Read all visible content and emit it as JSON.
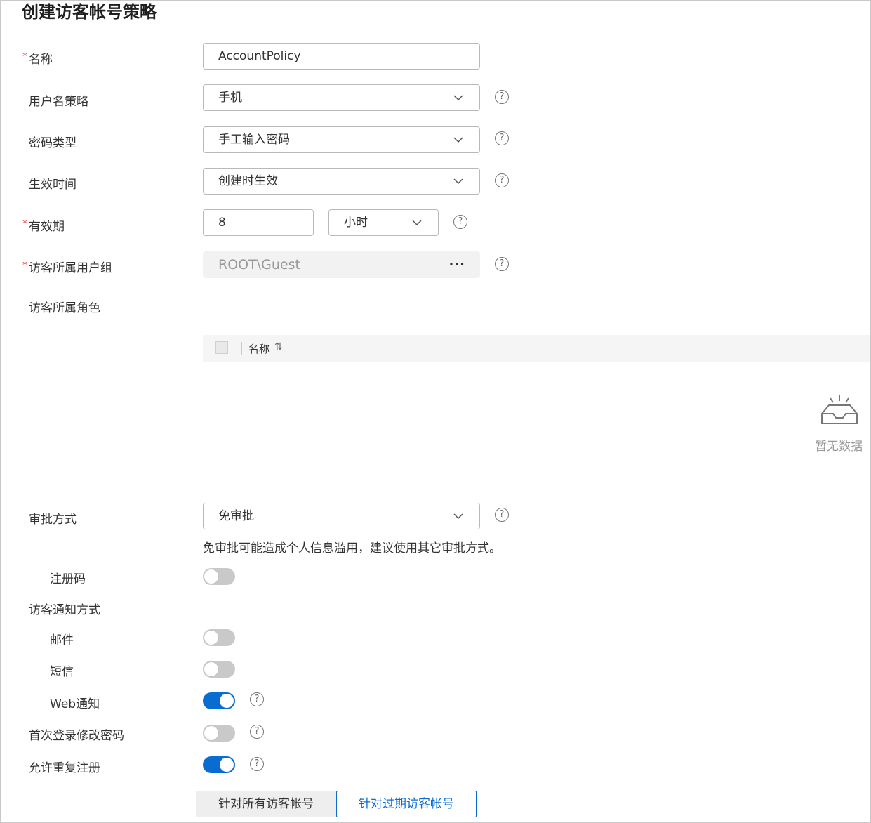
{
  "page": {
    "title": "创建访客帐号策略"
  },
  "form": {
    "name": {
      "label": "名称",
      "value": "AccountPolicy",
      "required": true
    },
    "username_policy": {
      "label": "用户名策略",
      "value": "手机"
    },
    "password_type": {
      "label": "密码类型",
      "value": "手工输入密码"
    },
    "effective_time": {
      "label": "生效时间",
      "value": "创建时生效"
    },
    "validity": {
      "label": "有效期",
      "value": "8",
      "unit": "小时",
      "required": true
    },
    "user_group": {
      "label": "访客所属用户组",
      "value": "ROOT\\Guest",
      "required": true
    },
    "role": {
      "label": "访客所属角色"
    },
    "approval": {
      "label": "审批方式",
      "value": "免审批",
      "hint": "免审批可能造成个人信息滥用，建议使用其它审批方式。"
    },
    "reg_code": {
      "label": "注册码",
      "enabled": false
    },
    "notify": {
      "label": "访客通知方式"
    },
    "email": {
      "label": "邮件",
      "enabled": false
    },
    "sms": {
      "label": "短信",
      "enabled": false
    },
    "web": {
      "label": "Web通知",
      "enabled": true
    },
    "first_login": {
      "label": "首次登录修改密码",
      "enabled": false
    },
    "allow_repeat": {
      "label": "允许重复注册",
      "enabled": true
    }
  },
  "table": {
    "column_name": "名称",
    "sort_icon": "⇅",
    "empty_text": "暂无数据"
  },
  "segment": {
    "all_label": "针对所有访客帐号",
    "expired_label": "针对过期访客帐号"
  },
  "icons": {
    "required_mark": "*",
    "help_glyph": "?",
    "more": "···"
  },
  "colors": {
    "accent": "#0a6bd1",
    "required": "#e5413f"
  }
}
